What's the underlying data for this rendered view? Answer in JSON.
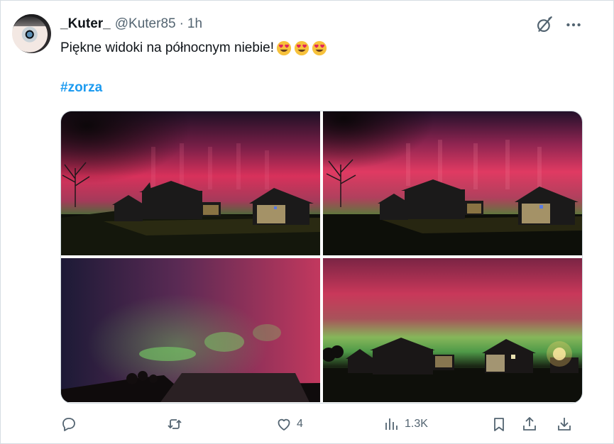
{
  "author": {
    "display_name": "_Kuter_",
    "handle": "@Kuter85",
    "separator": "·",
    "time": "1h"
  },
  "tweet": {
    "text": "Piękne widoki na północnym niebie!",
    "emojis": [
      "heart-eyes-emoji",
      "heart-eyes-emoji",
      "heart-eyes-emoji"
    ],
    "hashtag": "#zorza"
  },
  "header_icons": [
    "grok-icon",
    "more-icon"
  ],
  "media": {
    "count": 4,
    "photos": [
      "aurora-photo",
      "aurora-photo",
      "aurora-photo",
      "aurora-photo"
    ]
  },
  "actions": {
    "reply": {
      "icon": "reply-icon",
      "count": ""
    },
    "retweet": {
      "icon": "retweet-icon",
      "count": ""
    },
    "like": {
      "icon": "heart-icon",
      "count": "4"
    },
    "views": {
      "icon": "views-icon",
      "count": "1.3K"
    },
    "bookmark": {
      "icon": "bookmark-icon"
    },
    "share": {
      "icon": "share-icon"
    },
    "download": {
      "icon": "download-icon"
    }
  },
  "colors": {
    "text": "#0f1419",
    "secondary": "#536471",
    "link": "#1d9bf0",
    "aurora_red": "#d8315b",
    "aurora_green": "#5fd35a"
  }
}
